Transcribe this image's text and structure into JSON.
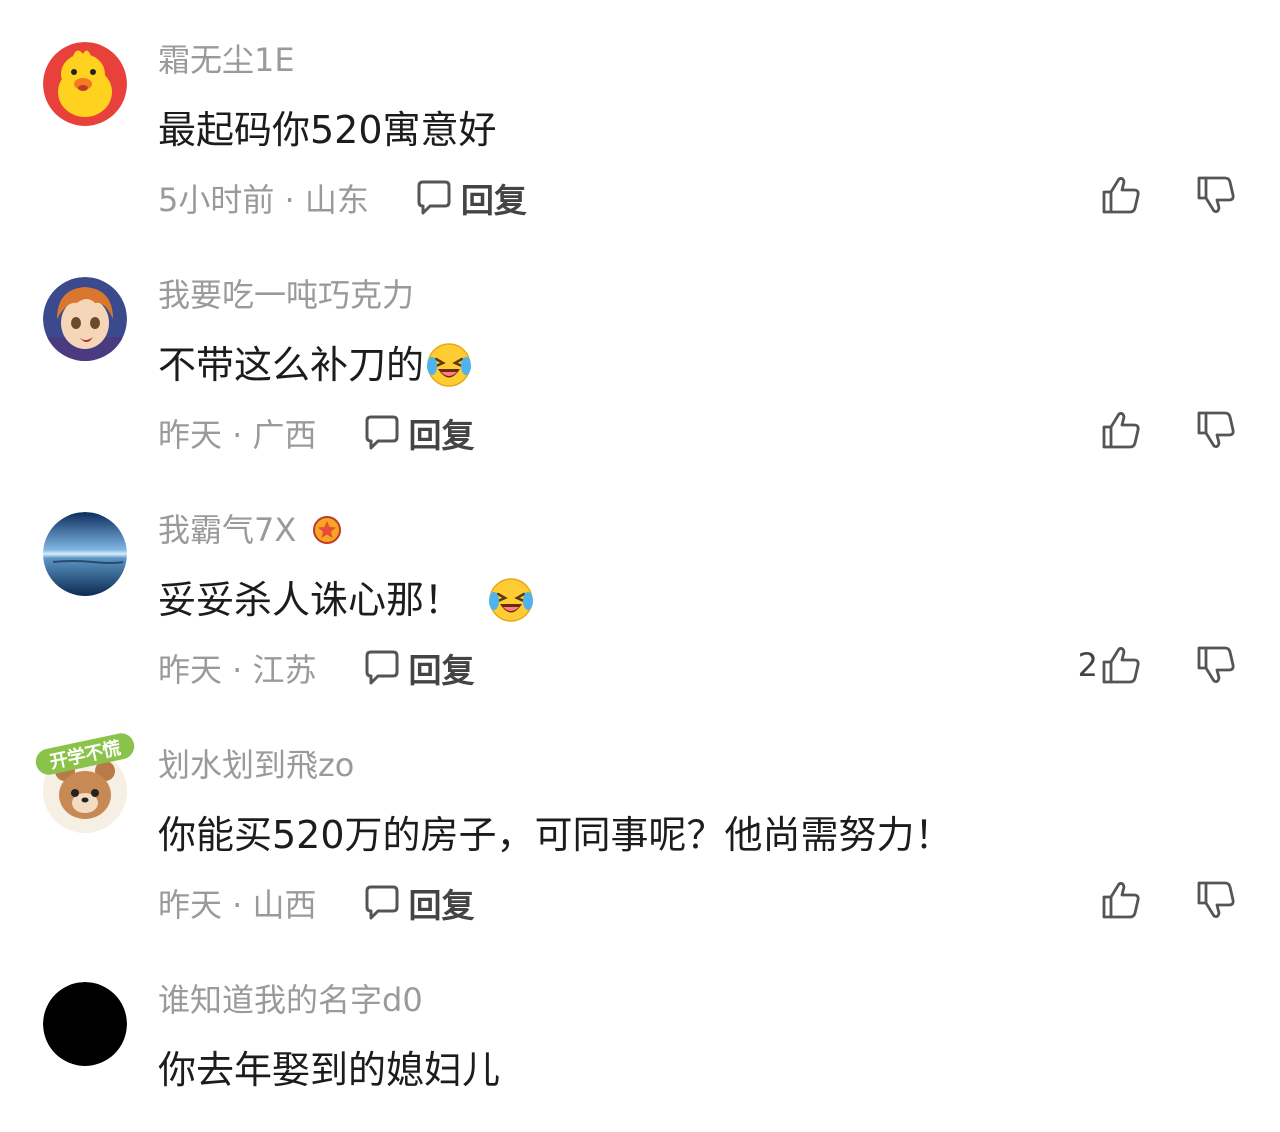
{
  "comments": [
    {
      "username": "霜无尘1E",
      "content": "最起码你520寓意好",
      "time_location": "5小时前 · 山东",
      "reply_label": "回复",
      "likes": "",
      "avatar": "yellow-duck-avatar"
    },
    {
      "username": "我要吃一吨巧克力",
      "content": "不带这么补刀的",
      "emoji": "laughing-crying-emoji",
      "time_location": "昨天 · 广西",
      "reply_label": "回复",
      "likes": "",
      "avatar": "anime-boy-avatar"
    },
    {
      "username": "我霸气7X",
      "badge": "star-badge",
      "content": "妥妥杀人诛心那！",
      "emoji": "laughing-crying-emoji",
      "time_location": "昨天 · 江苏",
      "reply_label": "回复",
      "likes": "2",
      "avatar": "lake-landscape-avatar"
    },
    {
      "username": "划水划到飛zo",
      "content": "你能买520万的房子，可同事呢？他尚需努力！",
      "time_location": "昨天 · 山西",
      "reply_label": "回复",
      "likes": "",
      "avatar": "bear-school-avatar",
      "avatar_sticker_text": "开学不慌"
    },
    {
      "username": "谁知道我的名字d0",
      "content": "你去年娶到的媳妇儿",
      "avatar": "black-avatar"
    }
  ],
  "colors": {
    "username": "#9a9a9a",
    "content": "#1c1c1c",
    "meta": "#9a9a9a",
    "icon": "#555555"
  }
}
